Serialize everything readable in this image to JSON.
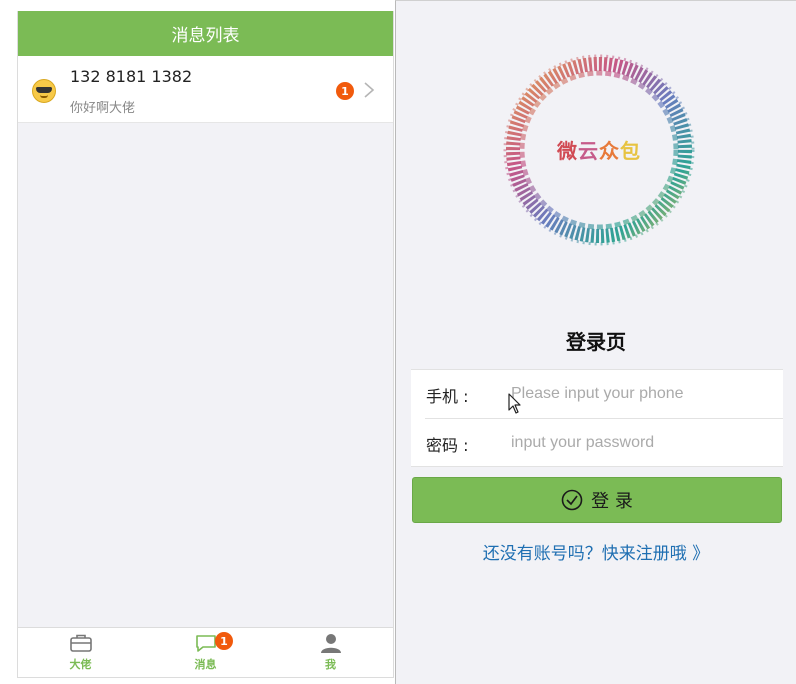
{
  "left": {
    "nav_title": "消息列表",
    "message": {
      "title": "132 8181 1382",
      "subtitle": "你好啊大佬",
      "badge": "1",
      "avatar": "sunglasses-emoji"
    },
    "tabs": [
      {
        "label": "大佬",
        "icon": "briefcase-icon"
      },
      {
        "label": "消息",
        "icon": "chat-bubble-icon",
        "badge": "1"
      },
      {
        "label": "我",
        "icon": "person-icon"
      }
    ],
    "colors": {
      "accent": "#7bbb55",
      "badge": "#f15a0c"
    }
  },
  "right": {
    "logo_text": [
      "微",
      "云",
      "众",
      "包"
    ],
    "login_title": "登录页",
    "phone_label": "手机 :",
    "phone_placeholder": "Please input your phone",
    "password_label": "密码 :",
    "password_placeholder": "input your password",
    "login_button": "登 录",
    "register_link": "还没有账号吗？快来注册哦 》",
    "colors": {
      "button": "#7bbb55",
      "link": "#1f6fb2"
    }
  }
}
